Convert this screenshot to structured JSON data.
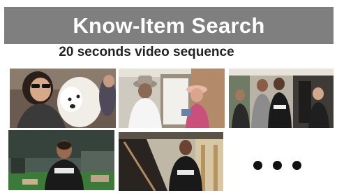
{
  "slide": {
    "title": "Know-Item Search",
    "subtitle": "20 seconds video sequence"
  },
  "thumbnails": [
    {
      "id": "frame-1",
      "scene": "woman-with-white-dog"
    },
    {
      "id": "frame-2",
      "scene": "two-people-at-door",
      "sign_text": "2123"
    },
    {
      "id": "frame-3",
      "scene": "group-outside-building",
      "sign_text": "2123"
    },
    {
      "id": "frame-4",
      "scene": "man-in-gym"
    },
    {
      "id": "frame-5",
      "scene": "man-on-stairs"
    }
  ],
  "more_indicator": "ellipsis-dots",
  "colors": {
    "banner": "#7f7f7f",
    "title_text": "#ffffff"
  }
}
